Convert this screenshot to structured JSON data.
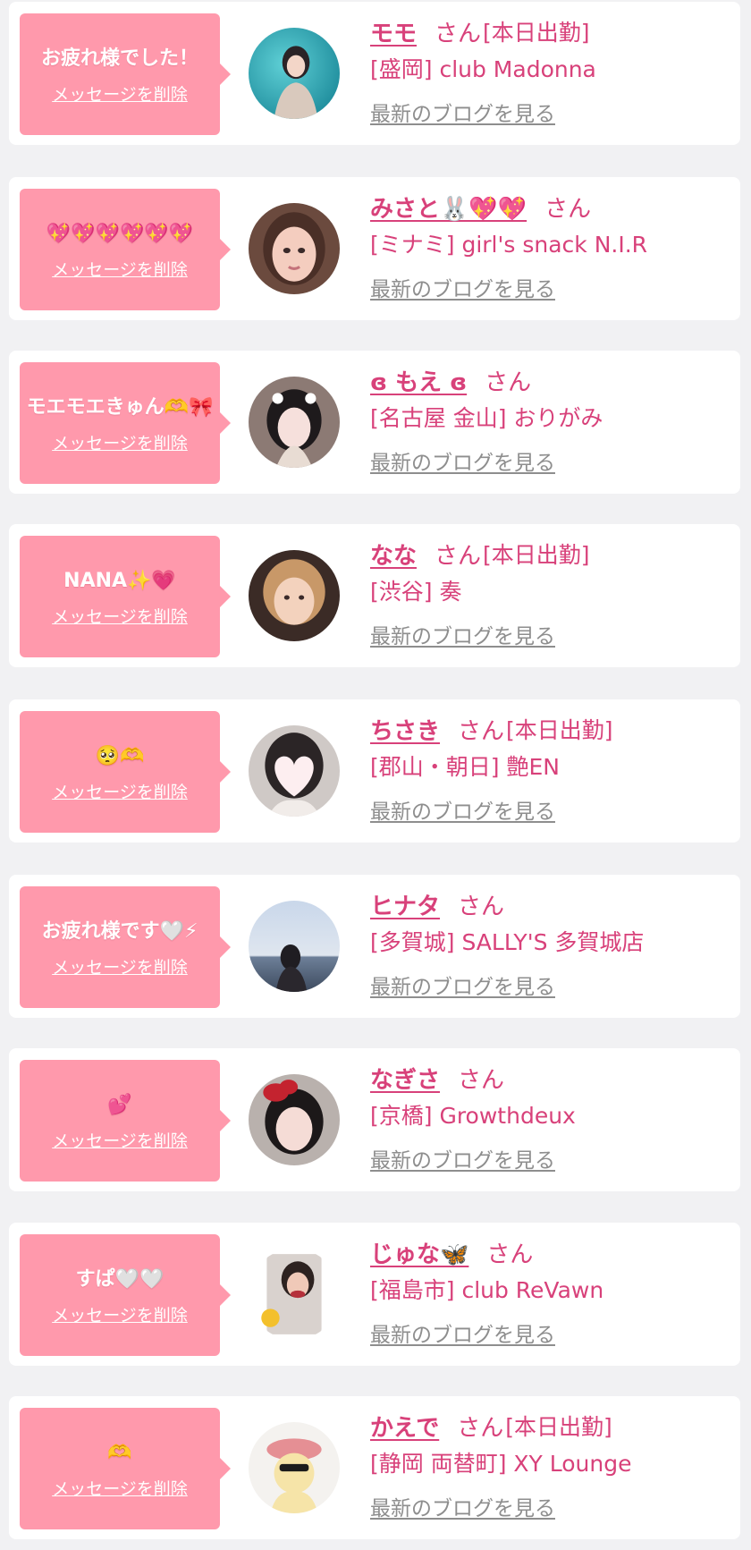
{
  "common": {
    "delete_label": "メッセージを削除",
    "honorific": "さん",
    "blog_label": "最新のブログを見る"
  },
  "colors": {
    "page_background": "#f1f1f3",
    "bubble": "#ff99ac",
    "accent_text": "#d8417a",
    "muted_link": "#8e8e8e"
  },
  "items": [
    {
      "message": "お疲れ様でした！",
      "name": "モモ",
      "shift": "[本日出勤]",
      "shop": "[盛岡] club Madonna"
    },
    {
      "message": "💖💖💖💖💖💖",
      "name": "みさと🐰💖💖",
      "shift": "",
      "shop": "[ミナミ] girl's snack N.I.R"
    },
    {
      "message": "モエモエきゅん🫶🎀",
      "name": "ɞ もえ ɞ",
      "shift": "",
      "shop": "[名古屋 金山] おりがみ"
    },
    {
      "message": "NANA✨💗",
      "name": "なな",
      "shift": "[本日出勤]",
      "shop": "[渋谷] 奏"
    },
    {
      "message": "🥺🫶",
      "name": "ちさき",
      "shift": "[本日出勤]",
      "shop": "[郡山・朝日] 艶EN"
    },
    {
      "message": "お疲れ様です🤍⚡",
      "name": "ヒナタ",
      "shift": "",
      "shop": "[多賀城] SALLY'S 多賀城店"
    },
    {
      "message": "💕",
      "name": "なぎさ",
      "shift": "",
      "shop": "[京橋] Growthdeux"
    },
    {
      "message": "すぱ🤍🤍",
      "name": "じゅな🦋",
      "shift": "",
      "shop": "[福島市] club ReVawn"
    },
    {
      "message": "🫶",
      "name": "かえで",
      "shift": "[本日出勤]",
      "shop": "[静岡 両替町] XY Lounge"
    }
  ]
}
